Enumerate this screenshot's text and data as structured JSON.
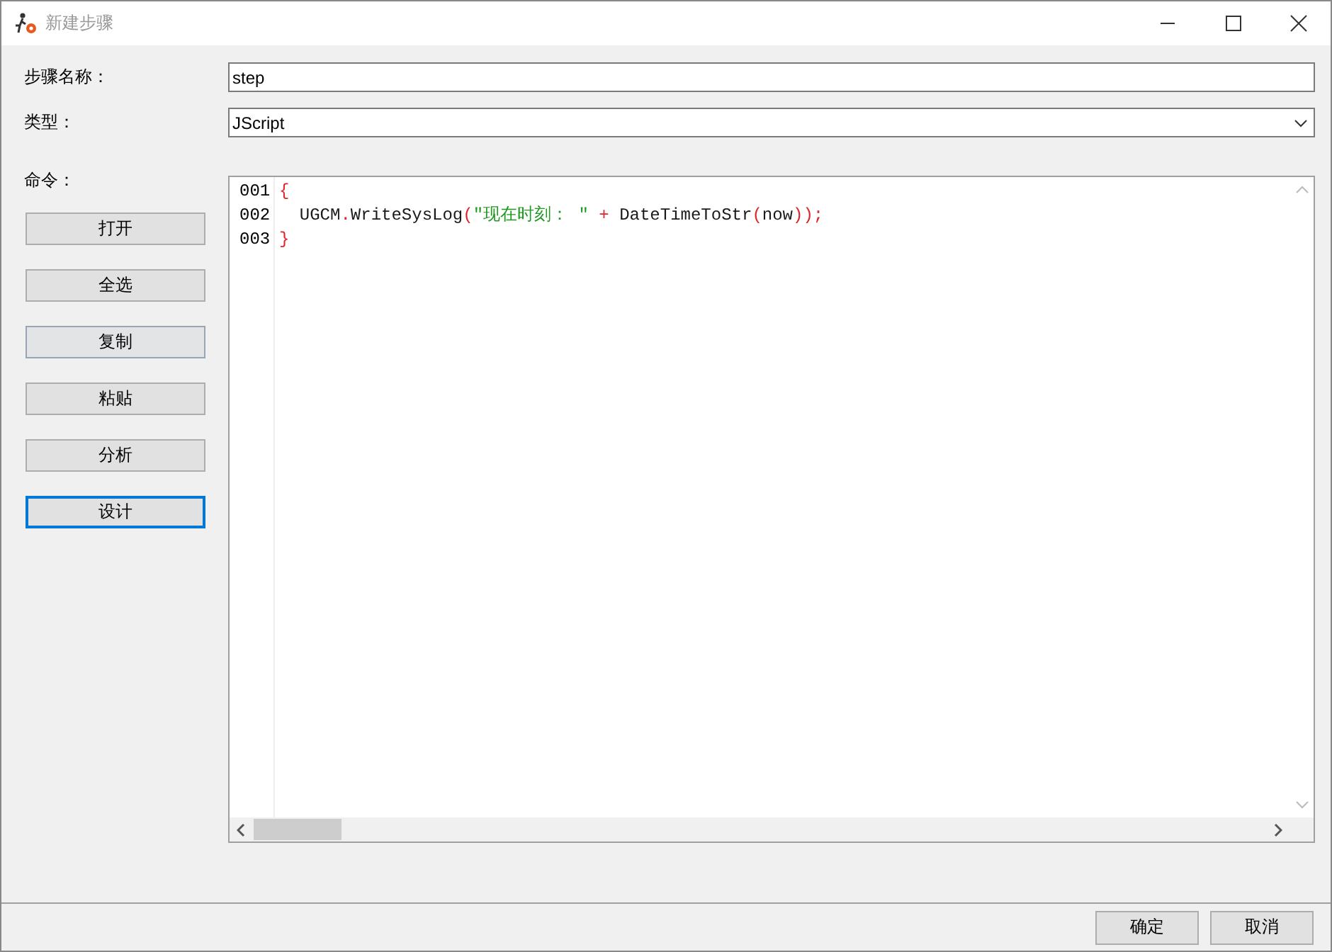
{
  "window": {
    "title": "新建步骤"
  },
  "fields": [
    {
      "label": "步骤名称：",
      "kind": "text",
      "value": "step"
    },
    {
      "label": "类型：",
      "kind": "select",
      "value": "JScript"
    }
  ],
  "command_label": "命令：",
  "side_buttons": [
    {
      "label": "打开",
      "hovered": false,
      "focused": false
    },
    {
      "label": "全选",
      "hovered": false,
      "focused": false
    },
    {
      "label": "复制",
      "hovered": true,
      "focused": false
    },
    {
      "label": "粘贴",
      "hovered": false,
      "focused": false
    },
    {
      "label": "分析",
      "hovered": false,
      "focused": false
    },
    {
      "label": "设计",
      "hovered": false,
      "focused": true
    }
  ],
  "editor": {
    "lines": [
      {
        "number": "001",
        "tokens": [
          {
            "text": "{",
            "kind": "punct"
          }
        ]
      },
      {
        "number": "002",
        "tokens": [
          {
            "text": "  UGCM",
            "kind": "ident"
          },
          {
            "text": ".",
            "kind": "punct"
          },
          {
            "text": "WriteSysLog",
            "kind": "ident"
          },
          {
            "text": "(",
            "kind": "punct"
          },
          {
            "text": "\"现在时刻： \"",
            "kind": "string"
          },
          {
            "text": " + ",
            "kind": "punct"
          },
          {
            "text": "DateTimeToStr",
            "kind": "ident"
          },
          {
            "text": "(",
            "kind": "punct"
          },
          {
            "text": "now",
            "kind": "ident"
          },
          {
            "text": "));",
            "kind": "punct"
          }
        ]
      },
      {
        "number": "003",
        "tokens": [
          {
            "text": "}",
            "kind": "punct"
          }
        ]
      }
    ]
  },
  "footer_buttons": [
    "确定",
    "取消"
  ]
}
